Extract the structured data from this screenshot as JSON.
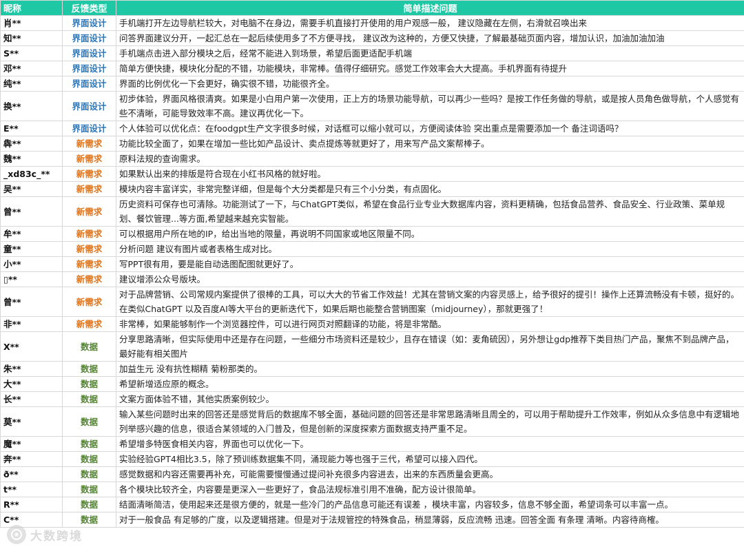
{
  "header": {
    "name": "昵称",
    "type": "反馈类型",
    "desc": "简单描述问题"
  },
  "colors": {
    "header_bg": "#1ec8a5",
    "ui": "#2e75b6",
    "new": "#e0741b",
    "data": "#548235"
  },
  "watermark": {
    "icon": "logo-icon",
    "text": "大数跨境"
  },
  "rows": [
    {
      "name": "肖**",
      "type": "界面设计",
      "cls": "blue",
      "lines": 1,
      "desc": "手机端打开左边导航栏较大，对电脑不在身边，需要手机直接打开使用的用户观感一般， 建议隐藏在左侧，右滑就召唤出来"
    },
    {
      "name": "知**",
      "type": "界面设计",
      "cls": "blue",
      "lines": 1,
      "desc": "问答界面建议分开，一起汇总在一起后续使用多了不方便寻找， 建议改为这种的，方便又快捷，了解最基础页面内容，增加认识，加油加油加油"
    },
    {
      "name": "S**",
      "type": "界面设计",
      "cls": "blue",
      "lines": 1,
      "desc": "手机端点击进入部分模块之后，经常不能进入到场景，希望后面更适配手机端"
    },
    {
      "name": "邓**",
      "type": "界面设计",
      "cls": "blue",
      "lines": 1,
      "desc": "简单方便快捷，模块化分配的不错，功能模块，非常棒。值得仔细研究。感觉工作效率会大大提高。手机界面有待提升"
    },
    {
      "name": "纯**",
      "type": "界面设计",
      "cls": "blue",
      "lines": 1,
      "desc": "界面的比例优化一下会更好，确实很不错，功能很齐全。"
    },
    {
      "name": "换**",
      "type": "界面设计",
      "cls": "blue",
      "lines": 2,
      "desc": "初步体验，界面风格很清爽。如果是小白用户第一次使用，正上方的场景功能导航，可以再少一些吗？是按工作任务做的导航，或是按人员角色做导航，个人感觉有些不清晰，可能导致效率不高。建议再优化一下。"
    },
    {
      "name": "E**",
      "type": "界面设计",
      "cls": "blue",
      "lines": 1,
      "desc": "个人体验可以优化点：在foodgpt生产文字很多时候，对话框可以缩小就可以，方便阅读体验 突出重点是需要添加一个 备注词语吗？"
    },
    {
      "name": "犇**",
      "type": "新需求",
      "cls": "orange",
      "lines": 1,
      "desc": "功能比较全面了，如果在增加一些比如产品设计、卖点提炼等就更好了，用来写产品文案帮棒子。"
    },
    {
      "name": "魏**",
      "type": "新需求",
      "cls": "orange",
      "lines": 1,
      "desc": "原料法规的查询需求。"
    },
    {
      "name": "_xd83c_**",
      "type": "新需求",
      "cls": "orange",
      "lines": 1,
      "desc": "如果默认出来的排版是符合现在小红书风格的就好啦。"
    },
    {
      "name": "吴**",
      "type": "新需求",
      "cls": "orange",
      "lines": 1,
      "desc": "模块内容丰富详实，非常完整详细，但是每个大分类都是只有三个小分类，有点固化。"
    },
    {
      "name": "曾**",
      "type": "新需求",
      "cls": "orange",
      "lines": 2,
      "desc": "历史资料可保存也可清除。功能测试了一下，与ChatGPT类似，希望在食品行业专业大数据库内容，资料更精确，包括食品营养、食品安全、行业政策、菜单规划、餐饮管理...等方面,希望越来越充实智能。"
    },
    {
      "name": "牟**",
      "type": "新需求",
      "cls": "orange",
      "lines": 1,
      "desc": "可以根据用户所在地的IP，给出当地的限量，再说明不同国家或地区限量不同。"
    },
    {
      "name": "童**",
      "type": "新需求",
      "cls": "orange",
      "lines": 1,
      "desc": "分析问题 建议有图片或者表格生成对比。"
    },
    {
      "name": "小**",
      "type": "新需求",
      "cls": "orange",
      "lines": 1,
      "desc": "写PPT很有用，要是能自动选图配图就更好了。"
    },
    {
      "name": "▯**",
      "type": "新需求",
      "cls": "orange",
      "lines": 1,
      "desc": "建议增添公众号版块。"
    },
    {
      "name": "曾**",
      "type": "新需求",
      "cls": "orange",
      "lines": 2,
      "desc": "对于品牌营销、公司常规内案提供了很棒的工具，可以大大的节省工作效益！尤其在营销文案的内容灵感上，给予很好的提引！操作上还算流畅没有卡顿，挺好的。在类似ChatGPT 以及百度AI等大平台的更新迭代下，如果后期也能整合营销图案（midjourney），那就更强了！"
    },
    {
      "name": "非**",
      "type": "新需求",
      "cls": "orange",
      "lines": 1,
      "desc": "非常棒，如果能够制作一个浏览器控件，可以进行网页对照翻译的功能，将是非常酷。"
    },
    {
      "name": "X**",
      "type": "数据",
      "cls": "green",
      "lines": 2,
      "desc": "分享思路清晰，但实际使用中还是存在问题，一些细分市场资料还是较少，且存在错误（如：麦角硫因），另外想让gdp推荐下类目热门产品，聚焦不到品牌产品，最好能有相关图片"
    },
    {
      "name": "朱**",
      "type": "数据",
      "cls": "green",
      "lines": 1,
      "desc": "加益生元 没有抗性糊精 菊粉那类的。"
    },
    {
      "name": "大**",
      "type": "数据",
      "cls": "green",
      "lines": 1,
      "desc": "希望新增适应原的概念。"
    },
    {
      "name": "长**",
      "type": "数据",
      "cls": "green",
      "lines": 1,
      "desc": "文案方面体验不错，其他实质案例较少。"
    },
    {
      "name": "莫**",
      "type": "数据",
      "cls": "green",
      "lines": 2,
      "desc": "输入某些问题时出来的回答还是感觉背后的数据库不够全面，基础问题的回答还是非常思路清晰且周全的，可以用于帮助提升工作效率，例如从众多信息中有逻辑地列举感兴趣的信息，很适合某领域的入门普及，但是创新的深度探索方面数据支持严重不足。"
    },
    {
      "name": "魔**",
      "type": "数据",
      "cls": "green",
      "lines": 1,
      "desc": "希望增多特医食相关内容，界面也可以优化一下。"
    },
    {
      "name": "奔**",
      "type": "数据",
      "cls": "green",
      "lines": 1,
      "desc": "实验经验GPT4相比3.5，除了预训练数据集不同，涌现能力等也强于三代，希望可以接入四代。"
    },
    {
      "name": "ð**",
      "type": "数据",
      "cls": "green",
      "lines": 1,
      "desc": "感觉数据和内容还需要再补充，可能需要慢慢通过提问补充很多内容进去，出来的东西质量会更高。"
    },
    {
      "name": "t**",
      "type": "数据",
      "cls": "green",
      "lines": 1,
      "desc": "各个模块比较齐全，内容要是更深入一些更好了，食品法规标准引用不准确，配方设计很简单。"
    },
    {
      "name": "R**",
      "type": "数据",
      "cls": "green",
      "lines": 1,
      "desc": "结面清晰简洁，使用起来还是很方便的，就是一些冷门的产品信息可能还有误差 ，模块丰富，内容较多，信息不够全面，希望词条可以丰富一点。"
    },
    {
      "name": "C**",
      "type": "数据",
      "cls": "green",
      "lines": 1,
      "desc": "对于一般食品 有足够的广度，以及逻辑搭建。但是对于法规管控的特殊食品，稍显薄弱，反应流畅 迅速。回答全面 有条理 清晰。内容待商榷。"
    }
  ]
}
